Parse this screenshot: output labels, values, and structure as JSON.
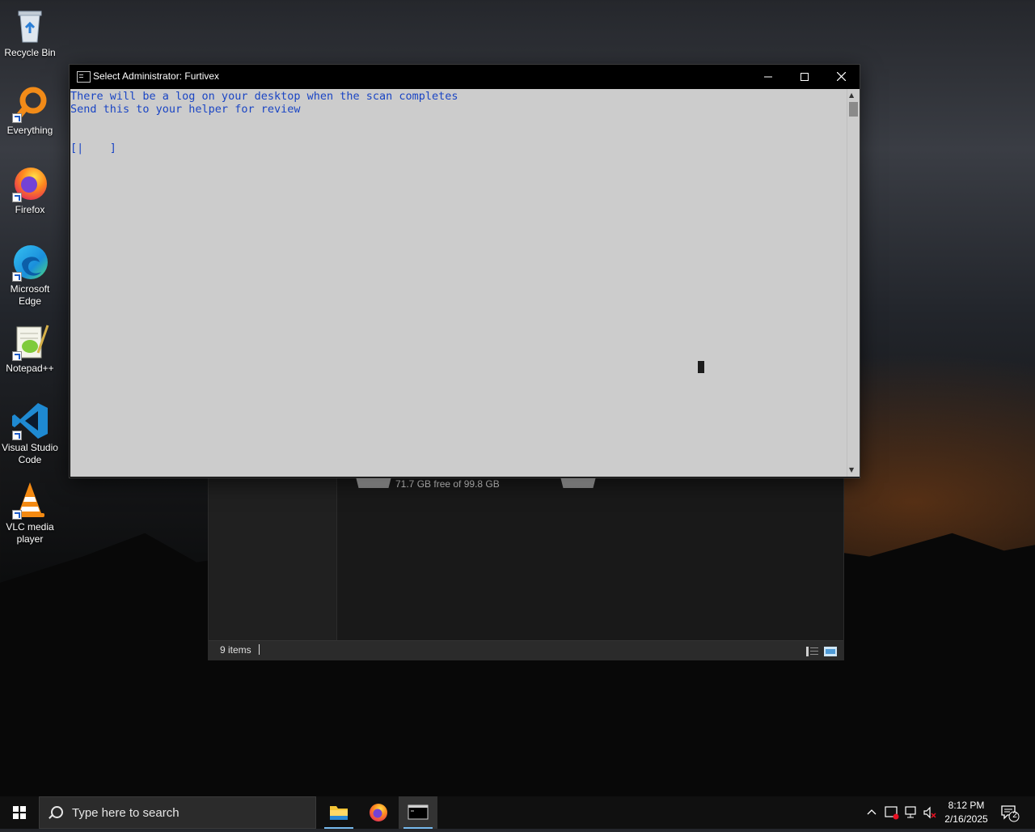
{
  "desktop": {
    "icons": [
      {
        "label": "Recycle Bin"
      },
      {
        "label": "Everything"
      },
      {
        "label": "Firefox"
      },
      {
        "label": "Microsoft Edge"
      },
      {
        "label": "Notepad++"
      },
      {
        "label": "Visual Studio Code"
      },
      {
        "label": "VLC media player"
      }
    ]
  },
  "explorer": {
    "drive_free_text": "71.7 GB free of 99.8 GB",
    "status_count": "9 items"
  },
  "console": {
    "title": "Select Administrator:  Furtivex",
    "lines": [
      "There will be a log on your desktop when the scan completes",
      "Send this to your helper for review",
      "",
      "",
      "[|    ]"
    ],
    "minimize": "—",
    "maximize": "☐",
    "close": "✕"
  },
  "taskbar": {
    "search_placeholder": "Type here to search",
    "apps": [
      "file-explorer",
      "firefox",
      "command-prompt"
    ],
    "active_app": "command-prompt",
    "time": "8:12 PM",
    "date": "2/16/2025",
    "notification_count": "2"
  },
  "colors": {
    "console_bg": "#cccccc",
    "console_text": "#1a45c4",
    "taskbar_bg": "#101010",
    "accent": "#76b9ed"
  }
}
